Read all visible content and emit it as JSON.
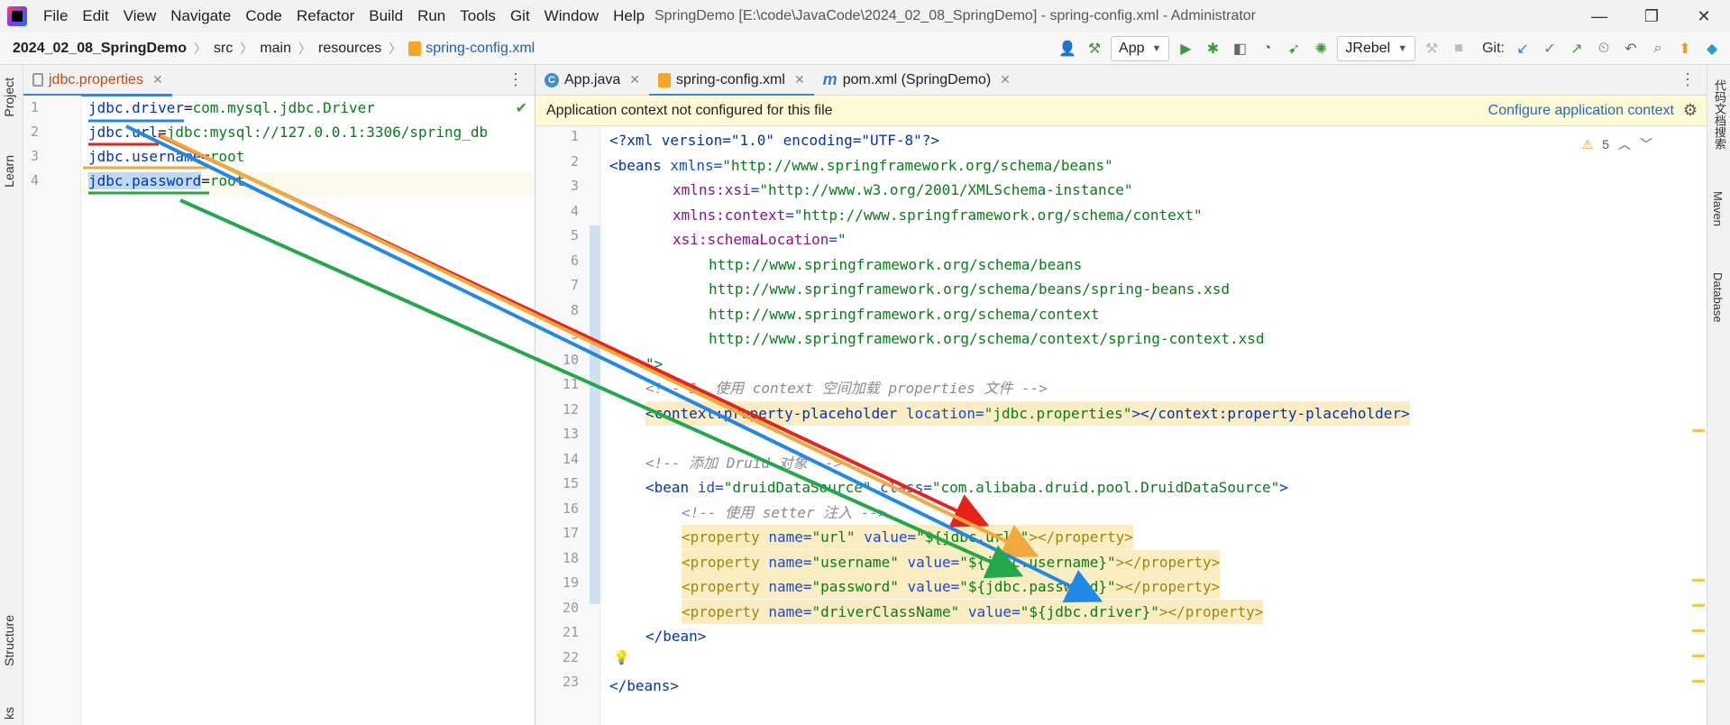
{
  "window": {
    "title": "SpringDemo [E:\\code\\JavaCode\\2024_02_08_SpringDemo] - spring-config.xml - Administrator",
    "menu": [
      "File",
      "Edit",
      "View",
      "Navigate",
      "Code",
      "Refactor",
      "Build",
      "Run",
      "Tools",
      "Git",
      "Window",
      "Help"
    ],
    "controls": {
      "minimize": "—",
      "restore": "❐",
      "close": "✕"
    }
  },
  "breadcrumb": {
    "project": "2024_02_08_SpringDemo",
    "items": [
      "src",
      "main",
      "resources"
    ],
    "file": "spring-config.xml"
  },
  "toolbar": {
    "run_config": "App",
    "jrebel": "JRebel",
    "git_label": "Git:"
  },
  "left_strip": {
    "project": "Project",
    "learn": "Learn",
    "structure": "Structure",
    "bookmarks": "ks"
  },
  "right_strip": {
    "labels": [
      "代码文档搜索",
      "Maven",
      "Database"
    ]
  },
  "left_editor": {
    "tab": "jdbc.properties",
    "lines": [
      {
        "no": "1",
        "key": "jdbc.driver",
        "eq": "=",
        "value": "com.mysql.jdbc.Driver"
      },
      {
        "no": "2",
        "key": "jdbc.url",
        "eq": "=",
        "value": "jdbc:mysql://127.0.0.1:3306/spring_db"
      },
      {
        "no": "3",
        "key": "jdbc.username",
        "eq": "=",
        "value": "root"
      },
      {
        "no": "4",
        "key": "jdbc.password",
        "eq": "=",
        "value": "root"
      }
    ]
  },
  "right_editor": {
    "tabs": [
      "App.java",
      "spring-config.xml",
      "pom.xml (SpringDemo)"
    ],
    "banner": "Application context not configured for this file",
    "banner_link": "Configure application context",
    "warnings": "5",
    "line_numbers": [
      "1",
      "2",
      "3",
      "4",
      "5",
      "6",
      "7",
      "8",
      "9",
      "10",
      "11",
      "12",
      "13",
      "14",
      "15",
      "16",
      "17",
      "18",
      "19",
      "20",
      "21",
      "22",
      "23"
    ],
    "code": {
      "l1": "<?xml version=\"1.0\" encoding=\"UTF-8\"?>",
      "l2a": "<beans",
      "l2b": " xmlns=",
      "l2c": "\"http://www.springframework.org/schema/beans\"",
      "l3a": "xmlns:xsi",
      "l3b": "=",
      "l3c": "\"http://www.w3.org/2001/XMLSchema-instance\"",
      "l4a": "xmlns:context",
      "l4b": "=",
      "l4c": "\"http://www.springframework.org/schema/context\"",
      "l5a": "xsi:schemaLocation",
      "l5b": "=",
      "l5c": "\"",
      "l6": "http://www.springframework.org/schema/beans",
      "l7": "http://www.springframework.org/schema/beans/spring-beans.xsd",
      "l8": "http://www.springframework.org/schema/context",
      "l9": "http://www.springframework.org/schema/context/spring-context.xsd",
      "l10": "\">",
      "l11": "<!-- 1. 使用 context 空间加载 properties 文件 -->",
      "l12a": "<context:property-placeholder",
      "l12b": " location=",
      "l12c": "\"jdbc.properties\"",
      "l12d": "></context:property-placeholder>",
      "l14": "<!-- 添加 Druid 对象 -->",
      "l15a": "<bean",
      "l15b": " id=",
      "l15c": "\"druidDataSource\"",
      "l15d": " class=",
      "l15e": "\"com.alibaba.druid.pool.DruidDataSource\"",
      "l15f": ">",
      "l16": "<!-- 使用 setter 注入 -->",
      "l17": [
        "<property",
        " name=",
        "\"url\"",
        " value=",
        "\"${jdbc.url}\"",
        "></property>"
      ],
      "l18": [
        "<property",
        " name=",
        "\"username\"",
        " value=",
        "\"${jdbc.username}\"",
        "></property>"
      ],
      "l19": [
        "<property",
        " name=",
        "\"password\"",
        " value=",
        "\"${jdbc.password}\"",
        "></property>"
      ],
      "l20": [
        "<property",
        " name=",
        "\"driverClassName\"",
        " value=",
        "\"${jdbc.driver}\"",
        "></property>"
      ],
      "l21": "</bean>",
      "l23": "</beans>"
    }
  },
  "annotation_colors": {
    "red": "#e8221b",
    "orange": "#f2a93b",
    "blue": "#2188e8",
    "green": "#22a84a"
  }
}
